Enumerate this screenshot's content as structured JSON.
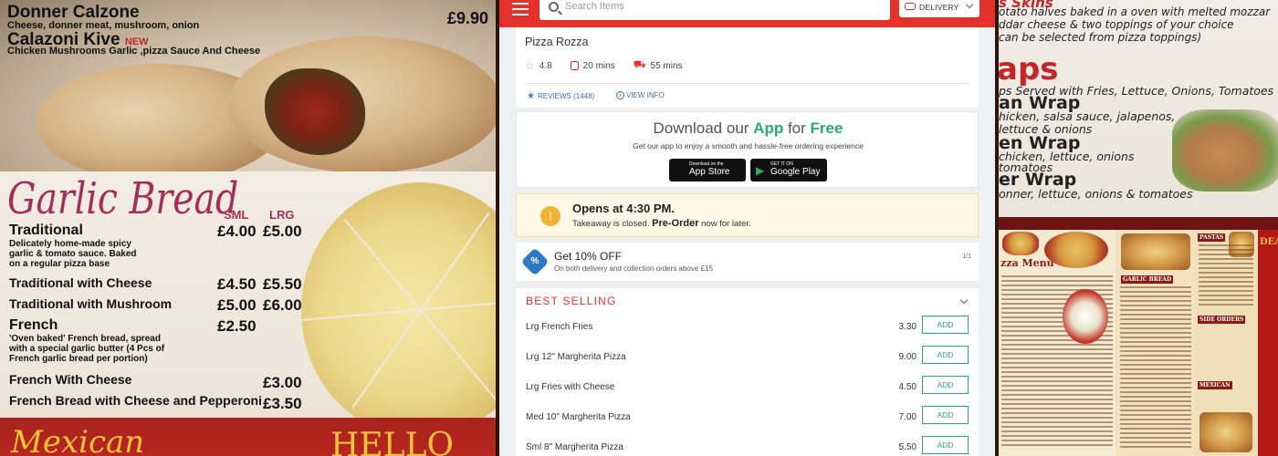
{
  "left_photo": {
    "donner_title": "Donner Calzone",
    "donner_desc": "Cheese, donner meat, mushroom, onion",
    "donner_price": "£9.90",
    "kive_title": "Calazoni Kive",
    "kive_badge": "NEW",
    "kive_desc": "Chicken Mushrooms Garlic ,pizza Sauce And Cheese",
    "garlic_title": "Garlic Bread",
    "col_sml": "SML",
    "col_lrg": "LRG",
    "rows": [
      {
        "name": "Traditional",
        "sml": "£4.00",
        "lrg": "£5.00"
      },
      {
        "name": "Traditional with Cheese",
        "sml": "£4.50",
        "lrg": "£5.50"
      },
      {
        "name": "Traditional with Mushroom",
        "sml": "£5.00",
        "lrg": "£6.00"
      },
      {
        "name": "French",
        "sml": "£2.50",
        "lrg": ""
      },
      {
        "name": "French With Cheese",
        "sml": "",
        "lrg": "£3.00"
      },
      {
        "name": "French Bread with Cheese and Pepperoni",
        "sml": "",
        "lrg": "£3.50"
      }
    ],
    "traditional_desc": "Delicately home-made spicy garlic & tomato sauce. Baked on a regular pizza base",
    "french_desc": "'Oven baked' French bread, spread with a special garlic butter (4 Pcs of French garlic bread per portion)",
    "mexican": "Mexican",
    "hello": "HELLO"
  },
  "app": {
    "search_placeholder": "Search Items",
    "delivery_label": "DELIVERY",
    "restaurant_name": "Pizza Rozza",
    "rating": "4.8",
    "collection_time": "20 mins",
    "delivery_time": "55 mins",
    "reviews_link": "REVIEWS (1448)",
    "view_info_link": "VIEW INFO",
    "download": {
      "prefix": "Download our",
      "app_word": "App",
      "for_word": "for",
      "free_word": "Free",
      "subtitle": "Get our app to enjoy a smooth and hassle-free ordering experience",
      "appstore_small": "Download on the",
      "appstore_big": "App Store",
      "googleplay_small": "GET IT ON",
      "googleplay_big": "Google Play"
    },
    "opens": {
      "title": "Opens at 4:30 PM.",
      "sub_prefix": "Takeaway is closed.",
      "sub_bold": "Pre-Order",
      "sub_suffix": "now for later."
    },
    "offer": {
      "title": "Get 10% OFF",
      "subtitle": "On both delivery and collection orders above £15",
      "pager": "1/1"
    },
    "section_title": "BEST SELLING",
    "add_label": "ADD",
    "items": [
      {
        "name": "Lrg French Fries",
        "price": "3.30"
      },
      {
        "name": "Lrg 12\" Margherita Pizza",
        "price": "9.00"
      },
      {
        "name": "Lrg Fries with Cheese",
        "price": "4.50"
      },
      {
        "name": "Med 10\" Margherita Pizza",
        "price": "7.00"
      },
      {
        "name": "Sml 8\" Margherita Pizza",
        "price": "5.50"
      }
    ]
  },
  "right_photo": {
    "skins_line1": "s Skins",
    "skins_line2": "otato halves baked in a oven with melted mozzar",
    "skins_line3": "ddar cheese & two toppings of your choice",
    "skins_line4": "can be selected from pizza toppings)",
    "wraps_title": "aps",
    "wraps_sub": "ps Served with Fries, Lettuce, Onions, Tomatoes &",
    "wrap1_title": "an Wrap",
    "wrap1_desc": "hicken, salsa sauce, jalapenos,",
    "wrap1_desc2": "lettuce & onions",
    "wrap2_title": "en Wrap",
    "wrap2_desc": "chicken, lettuce, onions",
    "wrap2_desc2": "tomatoes",
    "wrap3_title": "er Wrap",
    "wrap3_desc": "onner, lettuce, onions & tomatoes",
    "menu_title": "zza Menu",
    "col_pastas": "PASTAS",
    "col_garlic": "GARLIC BREAD",
    "col_side": "SIDE ORDERS",
    "col_mexican": "MEXICAN",
    "col_deals": "DEAL"
  }
}
